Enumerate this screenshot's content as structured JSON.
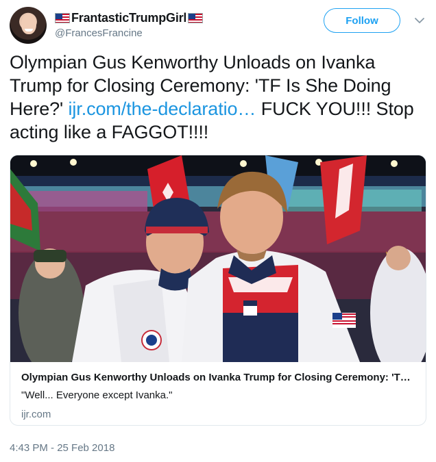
{
  "user": {
    "display_name": "FrantasticTrumpGirl",
    "handle": "@FrancesFrancine"
  },
  "follow_button_label": "Follow",
  "tweet": {
    "text_before_link": "Olympian Gus Kenworthy Unloads on Ivanka Trump for Closing Ceremony: 'TF Is She Doing Here?' ",
    "link": "ijr.com/the-declaratio…",
    "text_after_link": " FUCK YOU!!! Stop acting like a FAGGOT!!!!"
  },
  "card": {
    "title": "Olympian Gus Kenworthy Unloads on Ivanka Trump for Closing Ceremony: 'T…",
    "description": "\"Well... Everyone except Ivanka.\"",
    "domain": "ijr.com"
  },
  "timestamp": "4:43 PM - 25 Feb 2018",
  "icons": {
    "flag": "us-flag-emoji",
    "more": "chevron-down-icon"
  },
  "colors": {
    "accent": "#1da1f2",
    "link": "#1b95e0",
    "muted": "#657786"
  }
}
